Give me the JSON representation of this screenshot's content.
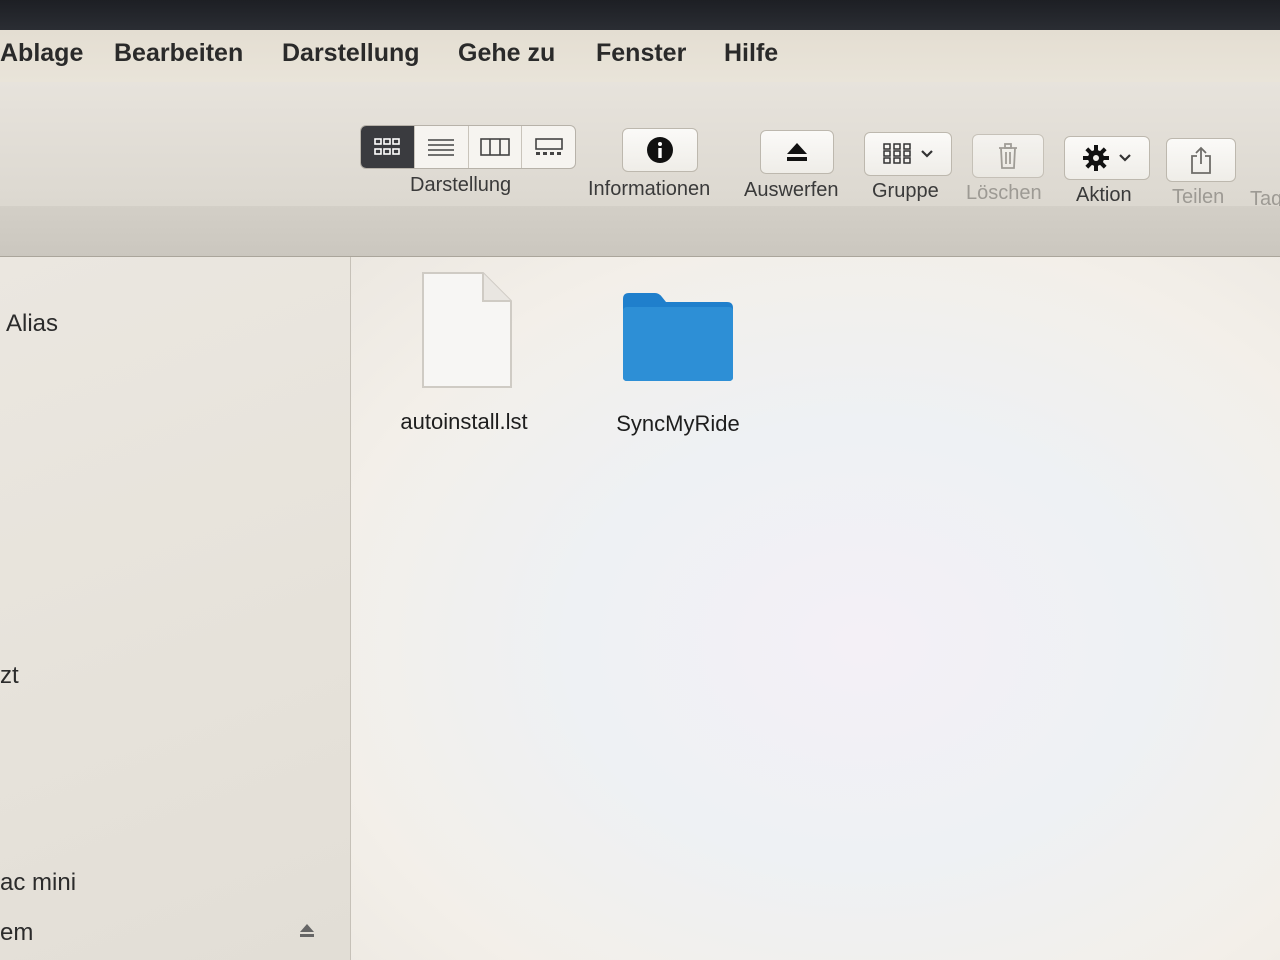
{
  "menubar": {
    "items": [
      "Ablage",
      "Bearbeiten",
      "Darstellung",
      "Gehe zu",
      "Fenster",
      "Hilfe"
    ]
  },
  "toolbar": {
    "view_label": "Darstellung",
    "view_modes": [
      "icon-view",
      "list-view",
      "column-view",
      "gallery-view"
    ],
    "active_view": "icon-view",
    "info_label": "Informationen",
    "eject_label": "Auswerfen",
    "group_label": "Gruppe",
    "delete_label": "Löschen",
    "action_label": "Aktion",
    "share_label": "Teilen",
    "tags_label": "Tag"
  },
  "sidebar": {
    "items": [
      "Alias",
      "zt",
      "ac mini",
      "em"
    ]
  },
  "files": [
    {
      "name": "autoinstall.lst",
      "kind": "document-icon"
    },
    {
      "name": "SyncMyRide",
      "kind": "folder-icon"
    }
  ],
  "colors": {
    "folder": "#2d8fd6",
    "active_segment": "#3a3b3f"
  }
}
